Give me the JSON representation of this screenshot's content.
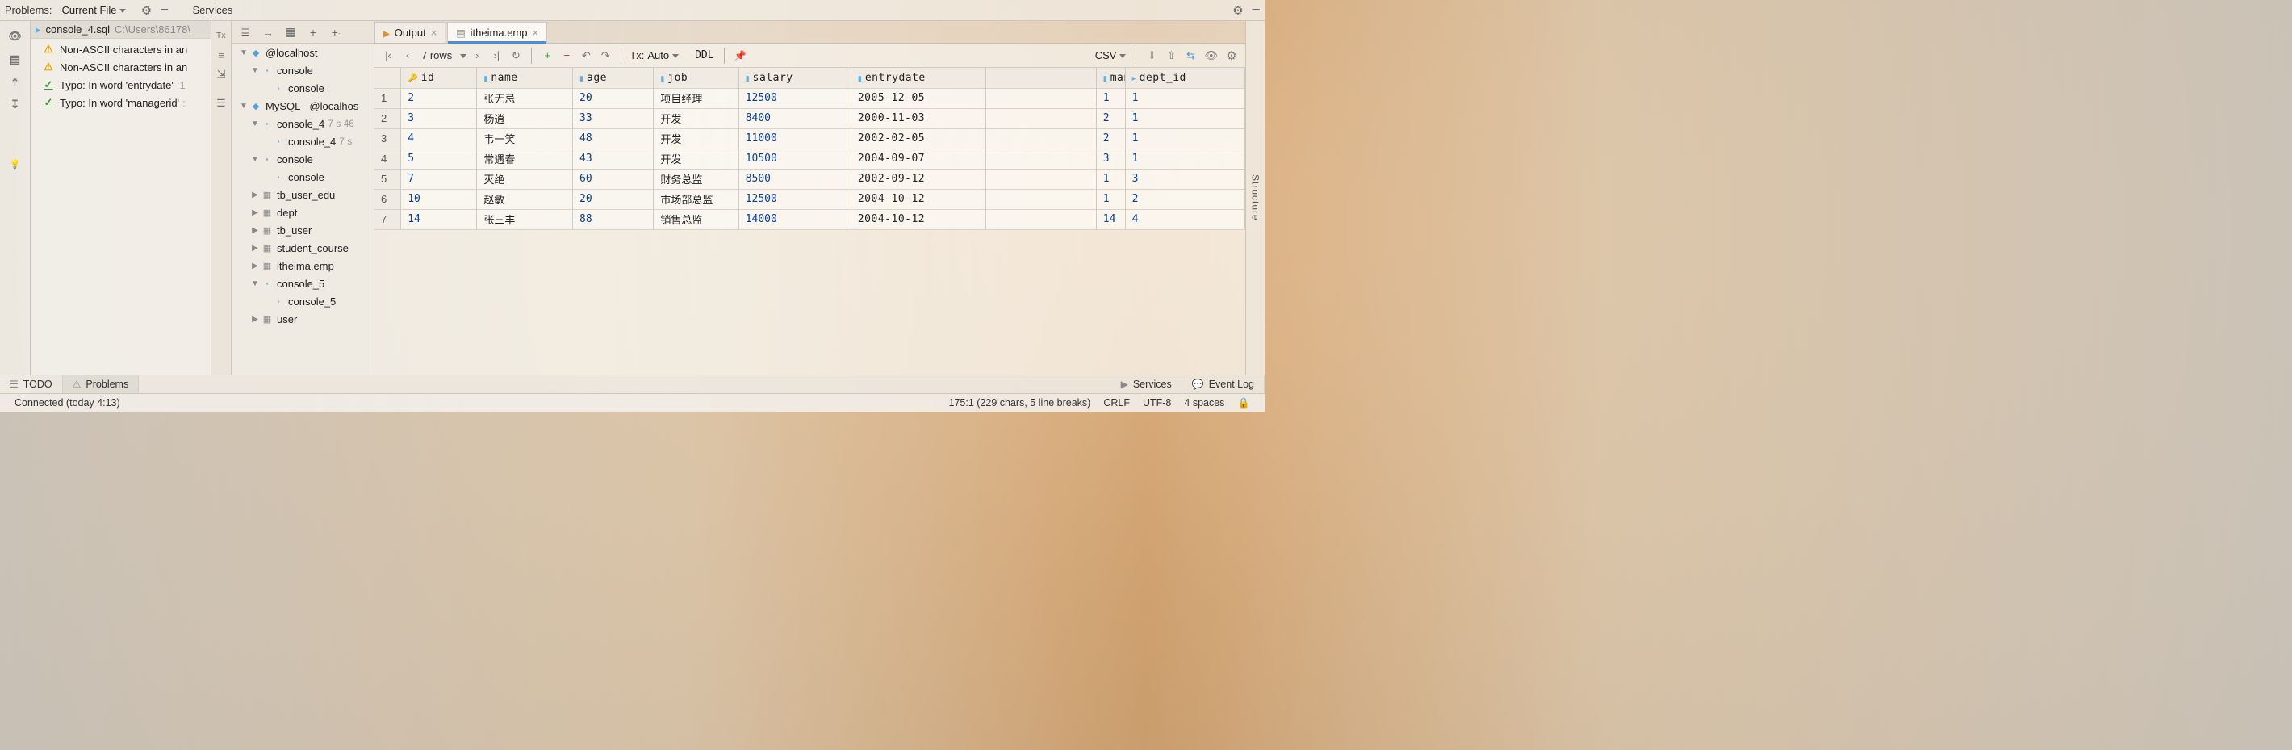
{
  "top": {
    "problems_label": "Problems:",
    "filter_value": "Current  File",
    "services_label": "Services"
  },
  "problems": {
    "file_name": "console_4.sql",
    "file_path": "C:\\Users\\86178\\",
    "items": [
      {
        "kind": "warn",
        "text": "Non-ASCII characters in an",
        "loc": ""
      },
      {
        "kind": "warn",
        "text": "Non-ASCII characters in an",
        "loc": ""
      },
      {
        "kind": "typo",
        "text": "Typo: In word 'entrydate'",
        "loc": ":1"
      },
      {
        "kind": "typo",
        "text": "Typo: In word 'managerid'",
        "loc": ":"
      }
    ]
  },
  "services_tree": [
    {
      "ind": 1,
      "twisty": "open",
      "icon": "dbsrc",
      "text": "@localhost",
      "hint": ""
    },
    {
      "ind": 2,
      "twisty": "open",
      "icon": "query",
      "text": "console",
      "hint": ""
    },
    {
      "ind": 3,
      "twisty": "",
      "icon": "query",
      "text": "console",
      "hint": ""
    },
    {
      "ind": 1,
      "twisty": "open",
      "icon": "dbsrc",
      "text": "MySQL - @localhos",
      "hint": ""
    },
    {
      "ind": 2,
      "twisty": "open",
      "icon": "query",
      "text": "console_4",
      "hint": "7 s 46"
    },
    {
      "ind": 3,
      "twisty": "",
      "icon": "query",
      "text": "console_4",
      "hint": "7 s"
    },
    {
      "ind": 2,
      "twisty": "open",
      "icon": "query",
      "text": "console",
      "hint": ""
    },
    {
      "ind": 3,
      "twisty": "",
      "icon": "query",
      "text": "console",
      "hint": ""
    },
    {
      "ind": 2,
      "twisty": "closed",
      "icon": "table-ic",
      "text": "tb_user_edu",
      "hint": ""
    },
    {
      "ind": 2,
      "twisty": "closed",
      "icon": "table-ic",
      "text": "dept",
      "hint": ""
    },
    {
      "ind": 2,
      "twisty": "closed",
      "icon": "table-ic",
      "text": "tb_user",
      "hint": ""
    },
    {
      "ind": 2,
      "twisty": "closed",
      "icon": "table-ic",
      "text": "student_course",
      "hint": ""
    },
    {
      "ind": 2,
      "twisty": "closed",
      "icon": "table-ic",
      "text": "itheima.emp",
      "hint": ""
    },
    {
      "ind": 2,
      "twisty": "open",
      "icon": "query",
      "text": "console_5",
      "hint": ""
    },
    {
      "ind": 3,
      "twisty": "",
      "icon": "query",
      "text": "console_5",
      "hint": ""
    },
    {
      "ind": 2,
      "twisty": "closed",
      "icon": "table-ic",
      "text": "user",
      "hint": ""
    }
  ],
  "editor_tabs": [
    {
      "icon": "out",
      "label": "Output",
      "active": false
    },
    {
      "icon": "tbl",
      "label": "itheima.emp",
      "active": true
    }
  ],
  "grid_toolbar": {
    "rows_text": "7 rows",
    "tx_label": "Tx:",
    "tx_value": "Auto",
    "ddl": "DDL",
    "export_fmt": "CSV"
  },
  "grid": {
    "columns": [
      {
        "key": "id",
        "label": "id",
        "kind": "key"
      },
      {
        "key": "name",
        "label": "name",
        "kind": "col"
      },
      {
        "key": "age",
        "label": "age",
        "kind": "col"
      },
      {
        "key": "job",
        "label": "job",
        "kind": "col"
      },
      {
        "key": "salary",
        "label": "salary",
        "kind": "col"
      },
      {
        "key": "entrydate",
        "label": "entrydate",
        "kind": "col"
      },
      {
        "key": "managerid",
        "label": "managerid",
        "kind": "col"
      },
      {
        "key": "dept_id",
        "label": "dept_id",
        "kind": "fk"
      }
    ],
    "rows": [
      {
        "n": 1,
        "id": 2,
        "name": "张无忌",
        "age": 20,
        "job": "项目经理",
        "salary": 12500,
        "entrydate": "2005-12-05",
        "managerid": 1,
        "dept_id": 1
      },
      {
        "n": 2,
        "id": 3,
        "name": "杨逍",
        "age": 33,
        "job": "开发",
        "salary": 8400,
        "entrydate": "2000-11-03",
        "managerid": 2,
        "dept_id": 1
      },
      {
        "n": 3,
        "id": 4,
        "name": "韦一笑",
        "age": 48,
        "job": "开发",
        "salary": 11000,
        "entrydate": "2002-02-05",
        "managerid": 2,
        "dept_id": 1
      },
      {
        "n": 4,
        "id": 5,
        "name": "常遇春",
        "age": 43,
        "job": "开发",
        "salary": 10500,
        "entrydate": "2004-09-07",
        "managerid": 3,
        "dept_id": 1
      },
      {
        "n": 5,
        "id": 7,
        "name": "灭绝",
        "age": 60,
        "job": "财务总监",
        "salary": 8500,
        "entrydate": "2002-09-12",
        "managerid": 1,
        "dept_id": 3
      },
      {
        "n": 6,
        "id": 10,
        "name": "赵敏",
        "age": 20,
        "job": "市场部总监",
        "salary": 12500,
        "entrydate": "2004-10-12",
        "managerid": 1,
        "dept_id": 2
      },
      {
        "n": 7,
        "id": 14,
        "name": "张三丰",
        "age": 88,
        "job": "销售总监",
        "salary": 14000,
        "entrydate": "2004-10-12",
        "managerid": 14,
        "dept_id": 4
      }
    ]
  },
  "right_rail": {
    "label": "Structure"
  },
  "bottom_tabs": {
    "todo": "TODO",
    "problems": "Problems",
    "services": "Services",
    "eventlog": "Event Log"
  },
  "statusbar": {
    "connected": "Connected (today 4:13)",
    "caret": "175:1 (229 chars, 5 line breaks)",
    "eol": "CRLF",
    "encoding": "UTF-8",
    "indent": "4 spaces"
  }
}
